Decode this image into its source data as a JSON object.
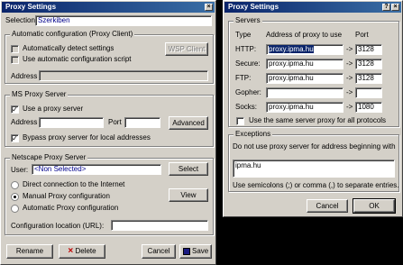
{
  "left": {
    "title": "Proxy Settings",
    "selection_label": "Selection",
    "selection_value": "Szerkiben",
    "auto_group": "Automatic configuration (Proxy Client)",
    "auto_detect": "Automatically detect settings",
    "auto_script": "Use automatic configuration script",
    "wsp_button": "WSP Client",
    "address_label": "Address",
    "ms_group": "MS Proxy Server",
    "use_proxy": "Use a proxy server",
    "address_label2": "Address",
    "port_label": "Port",
    "advanced_button": "Advanced",
    "bypass_local": "Bypass proxy server for local addresses",
    "ns_group": "Netscape Proxy Server",
    "user_label": "User:",
    "user_value": "<Non Selected>",
    "select_button": "Select",
    "direct_conn": "Direct connection to the Internet",
    "manual_conf": "Manual Proxy configuration",
    "auto_conf": "Automatic Proxy configuration",
    "view_button": "View",
    "conf_location": "Configuration location (URL):",
    "rename_button": "Rename",
    "delete_button": "Delete",
    "cancel_button": "Cancel",
    "save_button": "Save",
    "close_glyph": "×",
    "check_glyph": "✓"
  },
  "right": {
    "title": "Proxy Settings",
    "servers_group": "Servers",
    "col_type": "Type",
    "col_address": "Address of proxy to use",
    "col_port": "Port",
    "arrow_glyph": "->",
    "rows": [
      {
        "type": "HTTP:",
        "address": "proxy.ipma.hu",
        "port": "3128"
      },
      {
        "type": "Secure:",
        "address": "proxy.ipma.hu",
        "port": "3128"
      },
      {
        "type": "FTP:",
        "address": "proxy.ipma.hu",
        "port": "3128"
      },
      {
        "type": "Gopher:",
        "address": "",
        "port": ""
      },
      {
        "type": "Socks:",
        "address": "proxy.ipma.hu",
        "port": "1080"
      }
    ],
    "same_server": "Use the same server proxy for all protocols",
    "exceptions_group": "Exceptions",
    "exceptions_desc": "Do not use proxy server for address beginning with",
    "exceptions_value": "ipma.hu",
    "exceptions_hint": "Use semicolons (;) or comma (,) to separate entries.",
    "cancel_button": "Cancel",
    "ok_button": "OK",
    "help_glyph": "?",
    "close_glyph": "×"
  },
  "colors": {
    "title_start": "#0a246a",
    "title_end": "#3a6ea5",
    "dialog_bg": "#d4d0c8",
    "link_blue": "#00008b"
  }
}
